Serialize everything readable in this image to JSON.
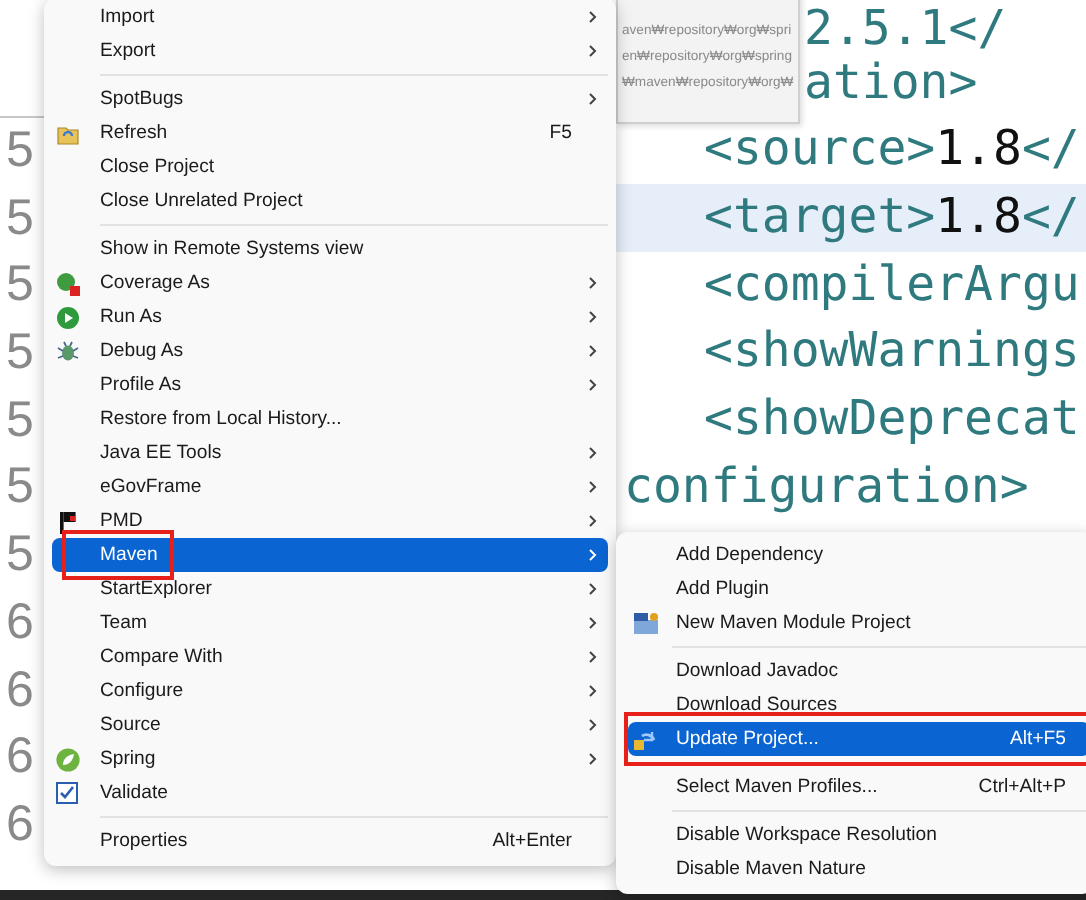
{
  "editor": {
    "line_numbers": [
      "5",
      "5",
      "5",
      "5",
      "5",
      "5",
      "5",
      "6",
      "6",
      "6",
      "6"
    ],
    "lines": [
      {
        "kind": "tail",
        "current": false,
        "parts": [
          {
            "text": "2.5.1</",
            "kind": "tag"
          }
        ]
      },
      {
        "kind": "tail",
        "current": false,
        "parts": [
          {
            "text": "ation>",
            "kind": "tag"
          }
        ]
      },
      {
        "kind": "inner",
        "current": false,
        "parts": [
          {
            "text": "<source>",
            "kind": "tag"
          },
          {
            "text": "1.8",
            "kind": "value"
          },
          {
            "text": "</",
            "kind": "tag"
          }
        ]
      },
      {
        "kind": "inner",
        "current": true,
        "parts": [
          {
            "text": "<target>",
            "kind": "tag"
          },
          {
            "text": "1.8",
            "kind": "value"
          },
          {
            "text": "</",
            "kind": "tag"
          }
        ]
      },
      {
        "kind": "inner",
        "current": false,
        "parts": [
          {
            "text": "<compilerArgu",
            "kind": "tag"
          }
        ]
      },
      {
        "kind": "inner",
        "current": false,
        "parts": [
          {
            "text": "<showWarnings",
            "kind": "tag"
          }
        ]
      },
      {
        "kind": "inner",
        "current": false,
        "parts": [
          {
            "text": "<showDeprecat",
            "kind": "tag"
          }
        ]
      },
      {
        "kind": "outer",
        "current": false,
        "parts": [
          {
            "text": "configuration>",
            "kind": "tag"
          }
        ]
      }
    ]
  },
  "tooltip": {
    "lines": [
      "aven₩repository₩org₩spri",
      "en₩repository₩org₩spring",
      "₩maven₩repository₩org₩"
    ]
  },
  "context_menu": {
    "items": [
      {
        "kind": "item",
        "label": "Import",
        "has_submenu": true,
        "selected": false,
        "annotated": false
      },
      {
        "kind": "item",
        "label": "Export",
        "has_submenu": true,
        "selected": false,
        "annotated": false
      },
      {
        "kind": "separator"
      },
      {
        "kind": "item",
        "label": "SpotBugs",
        "has_submenu": true,
        "selected": false,
        "annotated": false
      },
      {
        "kind": "item",
        "label": "Refresh",
        "shortcut": "F5",
        "has_submenu": false,
        "selected": false,
        "annotated": false
      },
      {
        "kind": "item",
        "label": "Close Project",
        "has_submenu": false,
        "selected": false,
        "annotated": false
      },
      {
        "kind": "item",
        "label": "Close Unrelated Project",
        "has_submenu": false,
        "selected": false,
        "annotated": false
      },
      {
        "kind": "separator"
      },
      {
        "kind": "item",
        "label": "Show in Remote Systems view",
        "has_submenu": false,
        "selected": false,
        "annotated": false
      },
      {
        "kind": "item",
        "label": "Coverage As",
        "has_submenu": true,
        "selected": false,
        "annotated": false
      },
      {
        "kind": "item",
        "label": "Run As",
        "has_submenu": true,
        "selected": false,
        "annotated": false
      },
      {
        "kind": "item",
        "label": "Debug As",
        "has_submenu": true,
        "selected": false,
        "annotated": false
      },
      {
        "kind": "item",
        "label": "Profile As",
        "has_submenu": true,
        "selected": false,
        "annotated": false
      },
      {
        "kind": "item",
        "label": "Restore from Local History...",
        "has_submenu": false,
        "selected": false,
        "annotated": false
      },
      {
        "kind": "item",
        "label": "Java EE Tools",
        "has_submenu": true,
        "selected": false,
        "annotated": false
      },
      {
        "kind": "item",
        "label": "eGovFrame",
        "has_submenu": true,
        "selected": false,
        "annotated": false
      },
      {
        "kind": "item",
        "label": "PMD",
        "has_submenu": true,
        "selected": false,
        "annotated": false
      },
      {
        "kind": "item",
        "label": "Maven",
        "has_submenu": true,
        "selected": true,
        "annotated": true
      },
      {
        "kind": "item",
        "label": "StartExplorer",
        "has_submenu": true,
        "selected": false,
        "annotated": false
      },
      {
        "kind": "item",
        "label": "Team",
        "has_submenu": true,
        "selected": false,
        "annotated": false
      },
      {
        "kind": "item",
        "label": "Compare With",
        "has_submenu": true,
        "selected": false,
        "annotated": false
      },
      {
        "kind": "item",
        "label": "Configure",
        "has_submenu": true,
        "selected": false,
        "annotated": false
      },
      {
        "kind": "item",
        "label": "Source",
        "has_submenu": true,
        "selected": false,
        "annotated": false
      },
      {
        "kind": "item",
        "label": "Spring",
        "has_submenu": true,
        "selected": false,
        "annotated": false
      },
      {
        "kind": "item",
        "label": "Validate",
        "checked": true,
        "has_submenu": false,
        "selected": false,
        "annotated": false
      },
      {
        "kind": "separator"
      },
      {
        "kind": "item",
        "label": "Properties",
        "shortcut": "Alt+Enter",
        "has_submenu": false,
        "selected": false,
        "annotated": false
      }
    ]
  },
  "submenu": {
    "items": [
      {
        "kind": "item",
        "label": "Add Dependency",
        "selected": false,
        "annotated": false
      },
      {
        "kind": "item",
        "label": "Add Plugin",
        "selected": false,
        "annotated": false
      },
      {
        "kind": "item",
        "label": "New Maven Module Project",
        "selected": false,
        "annotated": false
      },
      {
        "kind": "separator"
      },
      {
        "kind": "item",
        "label": "Download Javadoc",
        "selected": false,
        "annotated": false
      },
      {
        "kind": "item",
        "label": "Download Sources",
        "selected": false,
        "annotated": false
      },
      {
        "kind": "item",
        "label": "Update Project...",
        "shortcut": "Alt+F5",
        "selected": true,
        "annotated": true
      },
      {
        "kind": "separator"
      },
      {
        "kind": "item",
        "label": "Select Maven Profiles...",
        "shortcut": "Ctrl+Alt+P",
        "selected": false,
        "annotated": false
      },
      {
        "kind": "separator"
      },
      {
        "kind": "item",
        "label": "Disable Workspace Resolution",
        "selected": false,
        "annotated": false
      },
      {
        "kind": "item",
        "label": "Disable Maven Nature",
        "selected": false,
        "annotated": false
      }
    ]
  }
}
